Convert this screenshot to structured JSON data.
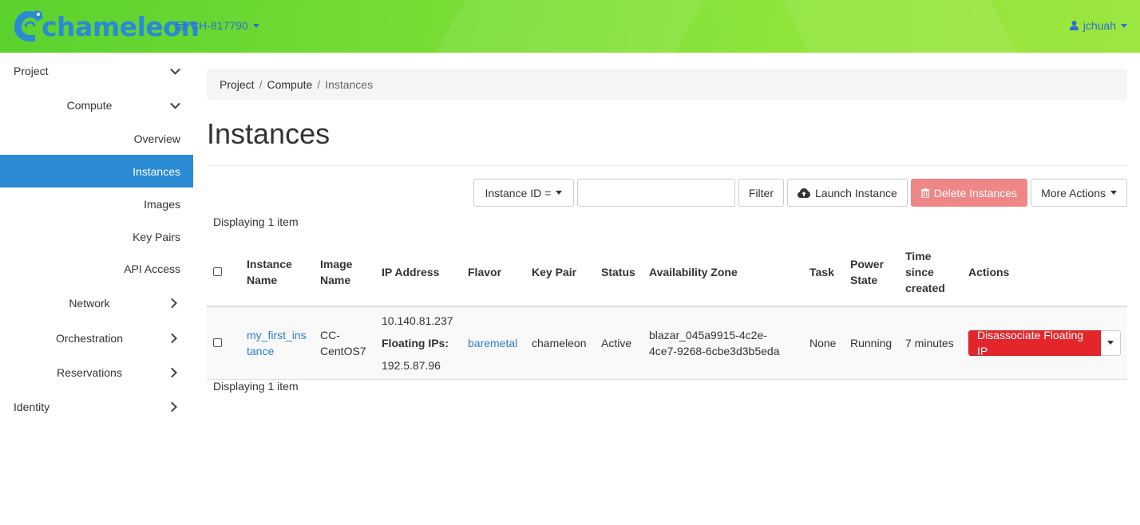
{
  "header": {
    "logo_text": "chameleon",
    "project": "CH-817790",
    "user": "jchuah"
  },
  "sidebar": {
    "project": "Project",
    "compute": "Compute",
    "items": [
      "Overview",
      "Instances",
      "Images",
      "Key Pairs",
      "API Access"
    ],
    "network": "Network",
    "orchestration": "Orchestration",
    "reservations": "Reservations",
    "identity": "Identity"
  },
  "breadcrumb": [
    "Project",
    "Compute",
    "Instances"
  ],
  "page_title": "Instances",
  "toolbar": {
    "filter_field": "Instance ID =",
    "filter_value": "",
    "filter_label": "Filter",
    "launch_label": "Launch Instance",
    "delete_label": "Delete Instances",
    "more_label": "More Actions"
  },
  "count_text": "Displaying 1 item",
  "table": {
    "headers": {
      "name": [
        "Instance",
        "Name"
      ],
      "image": [
        "Image",
        "Name"
      ],
      "ip": "IP Address",
      "flavor": "Flavor",
      "keypair": "Key Pair",
      "status": "Status",
      "az": "Availability Zone",
      "task": "Task",
      "power": [
        "Power",
        "State"
      ],
      "time": [
        "Time",
        "since",
        "created"
      ],
      "actions": "Actions"
    },
    "row": {
      "name": [
        "my_first_ins",
        "tance"
      ],
      "image": [
        "CC-",
        "CentOS7"
      ],
      "ip": "10.140.81.237",
      "floating_label": "Floating IPs:",
      "floating_ip": "192.5.87.96",
      "flavor": "baremetal",
      "keypair": "chameleon",
      "status": "Active",
      "az": [
        "blazar_045a9915-4c2e-",
        "4ce7-9268-6cbe3d3b5eda"
      ],
      "task": "None",
      "power": "Running",
      "time": "7 minutes",
      "action": "Disassociate Floating IP"
    }
  },
  "colors": {
    "accent": "#2a8ad4",
    "danger": "#e3262b",
    "link": "#2a7ccf"
  }
}
